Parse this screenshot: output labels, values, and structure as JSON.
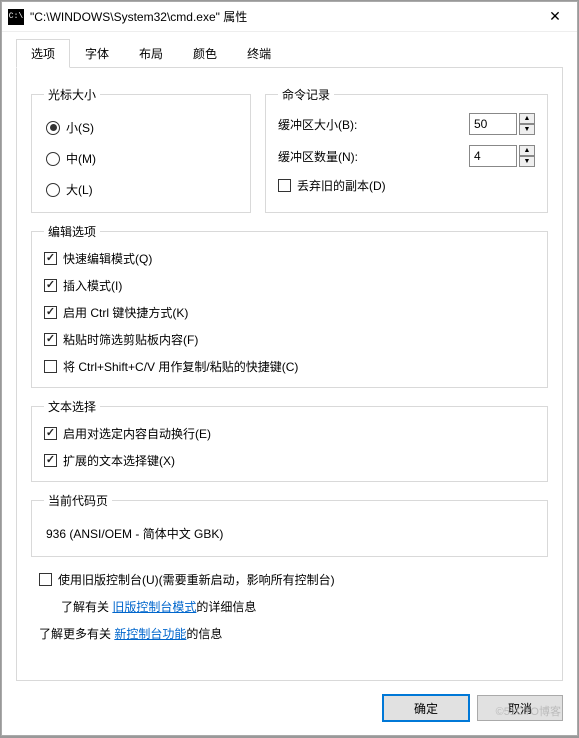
{
  "title": "\"C:\\WINDOWS\\System32\\cmd.exe\" 属性",
  "tabs": [
    "选项",
    "字体",
    "布局",
    "颜色",
    "终端"
  ],
  "active_tab": 0,
  "cursor_size": {
    "legend": "光标大小",
    "options": [
      "小(S)",
      "中(M)",
      "大(L)"
    ],
    "selected": 0
  },
  "history": {
    "legend": "命令记录",
    "buffer_size_label": "缓冲区大小(B):",
    "buffer_size_value": "50",
    "buffer_count_label": "缓冲区数量(N):",
    "buffer_count_value": "4",
    "discard_label": "丢弃旧的副本(D)",
    "discard_checked": false
  },
  "edit_options": {
    "legend": "编辑选项",
    "items": [
      {
        "label": "快速编辑模式(Q)",
        "checked": true
      },
      {
        "label": "插入模式(I)",
        "checked": true
      },
      {
        "label": "启用 Ctrl 键快捷方式(K)",
        "checked": true
      },
      {
        "label": "粘贴时筛选剪贴板内容(F)",
        "checked": true
      },
      {
        "label": "将 Ctrl+Shift+C/V 用作复制/粘贴的快捷键(C)",
        "checked": false
      }
    ]
  },
  "text_select": {
    "legend": "文本选择",
    "items": [
      {
        "label": "启用对选定内容自动换行(E)",
        "checked": true
      },
      {
        "label": "扩展的文本选择键(X)",
        "checked": true
      }
    ]
  },
  "code_page": {
    "legend": "当前代码页",
    "value": "936   (ANSI/OEM - 简体中文 GBK)"
  },
  "legacy": {
    "use_legacy_label": "使用旧版控制台(U)(需要重新启动，影响所有控制台)",
    "use_legacy_checked": false,
    "learn_legacy_prefix": "了解有关 ",
    "learn_legacy_link": "旧版控制台模式",
    "learn_legacy_suffix": "的详细信息",
    "learn_more_prefix": "了解更多有关 ",
    "learn_more_link": "新控制台功能",
    "learn_more_suffix": "的信息"
  },
  "buttons": {
    "ok": "确定",
    "cancel": "取消"
  },
  "watermark": "©51CTO博客"
}
